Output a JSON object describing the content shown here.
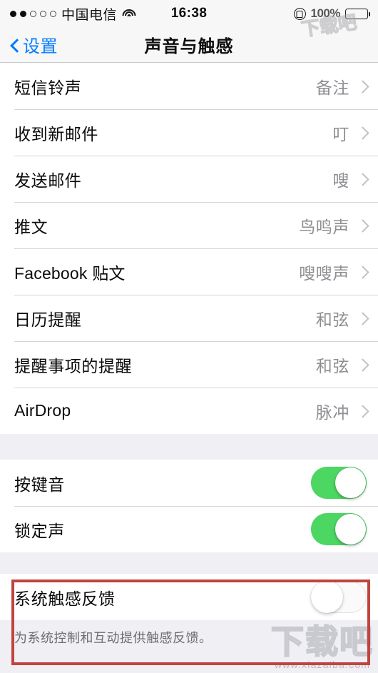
{
  "statusbar": {
    "signal_filled": 2,
    "signal_total": 5,
    "carrier": "中国电信",
    "wifi_icon": "wifi-icon",
    "time": "16:38",
    "rotation_lock_icon": "rotation-lock-icon",
    "battery_percent": "100%",
    "battery_icon": "battery-icon"
  },
  "navbar": {
    "back_label": "设置",
    "back_icon": "chevron-left-icon",
    "title": "声音与触感"
  },
  "sections": [
    {
      "id": "sound-picker-group",
      "rows": [
        {
          "label": "短信铃声",
          "value": "备注",
          "type": "disclosure"
        },
        {
          "label": "收到新邮件",
          "value": "叮",
          "type": "disclosure"
        },
        {
          "label": "发送邮件",
          "value": "嗖",
          "type": "disclosure"
        },
        {
          "label": "推文",
          "value": "鸟鸣声",
          "type": "disclosure"
        },
        {
          "label": "Facebook 贴文",
          "value": "嗖嗖声",
          "type": "disclosure"
        },
        {
          "label": "日历提醒",
          "value": "和弦",
          "type": "disclosure"
        },
        {
          "label": "提醒事项的提醒",
          "value": "和弦",
          "type": "disclosure"
        },
        {
          "label": "AirDrop",
          "value": "脉冲",
          "type": "disclosure"
        }
      ]
    },
    {
      "id": "sound-toggles-group",
      "rows": [
        {
          "label": "按键音",
          "type": "switch",
          "state": "on"
        },
        {
          "label": "锁定声",
          "type": "switch",
          "state": "on"
        }
      ]
    },
    {
      "id": "haptics-group",
      "rows": [
        {
          "label": "系统触感反馈",
          "type": "switch",
          "state": "off"
        }
      ],
      "footer": "为系统控制和互动提供触感反馈。"
    }
  ],
  "annotation": {
    "highlight_color": "#c0443d"
  },
  "watermark": {
    "main": "下载吧",
    "sub": "www.xiazaiba.com"
  },
  "colors": {
    "accent_blue": "#007aff",
    "switch_on_green": "#4cd662",
    "value_gray": "#8e8e93",
    "page_bg": "#efeff4"
  }
}
